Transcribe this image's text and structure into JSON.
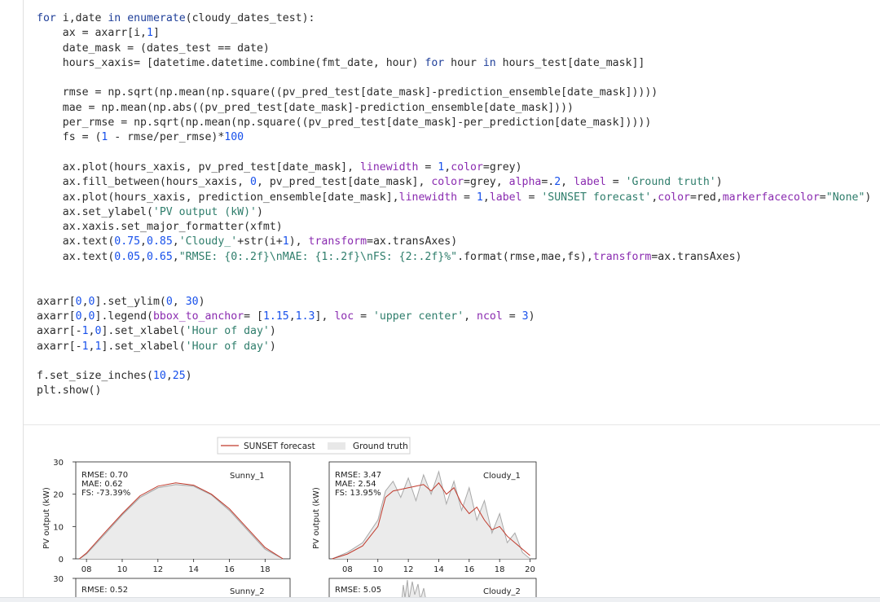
{
  "code": {
    "lines": [
      [
        {
          "t": "for",
          "c": "kw"
        },
        {
          "t": " i,date "
        },
        {
          "t": "in",
          "c": "kw"
        },
        {
          "t": " "
        },
        {
          "t": "enumerate",
          "c": "kw"
        },
        {
          "t": "(cloudy_dates_test):"
        }
      ],
      [
        {
          "t": "    ax = axarr[i,"
        },
        {
          "t": "1",
          "c": "num"
        },
        {
          "t": "]"
        }
      ],
      [
        {
          "t": "    date_mask = (dates_test == date)"
        }
      ],
      [
        {
          "t": "    hours_xaxis= [datetime.datetime.combine(fmt_date, hour) "
        },
        {
          "t": "for",
          "c": "kw"
        },
        {
          "t": " hour "
        },
        {
          "t": "in",
          "c": "kw"
        },
        {
          "t": " hours_test[date_mask]]"
        }
      ],
      [],
      [
        {
          "t": "    rmse = np.sqrt(np.mean(np.square((pv_pred_test[date_mask]-prediction_ensemble[date_mask]))))"
        }
      ],
      [
        {
          "t": "    mae = np.mean(np.abs((pv_pred_test[date_mask]-prediction_ensemble[date_mask])))"
        }
      ],
      [
        {
          "t": "    per_rmse = np.sqrt(np.mean(np.square((pv_pred_test[date_mask]-per_prediction[date_mask]))))"
        }
      ],
      [
        {
          "t": "    fs = ("
        },
        {
          "t": "1",
          "c": "num"
        },
        {
          "t": " - rmse/per_rmse)*"
        },
        {
          "t": "100",
          "c": "num"
        }
      ],
      [],
      [
        {
          "t": "    ax.plot(hours_xaxis, pv_pred_test[date_mask], "
        },
        {
          "t": "linewidth",
          "c": "kwarg"
        },
        {
          "t": " = "
        },
        {
          "t": "1",
          "c": "num"
        },
        {
          "t": ","
        },
        {
          "t": "color",
          "c": "kwarg"
        },
        {
          "t": "=grey)"
        }
      ],
      [
        {
          "t": "    ax.fill_between(hours_xaxis, "
        },
        {
          "t": "0",
          "c": "num"
        },
        {
          "t": ", pv_pred_test[date_mask], "
        },
        {
          "t": "color",
          "c": "kwarg"
        },
        {
          "t": "=grey, "
        },
        {
          "t": "alpha",
          "c": "kwarg"
        },
        {
          "t": "=."
        },
        {
          "t": "2",
          "c": "num"
        },
        {
          "t": ", "
        },
        {
          "t": "label",
          "c": "kwarg"
        },
        {
          "t": " = "
        },
        {
          "t": "'Ground truth'",
          "c": "str"
        },
        {
          "t": ")"
        }
      ],
      [
        {
          "t": "    ax.plot(hours_xaxis, prediction_ensemble[date_mask],"
        },
        {
          "t": "linewidth",
          "c": "kwarg"
        },
        {
          "t": " = "
        },
        {
          "t": "1",
          "c": "num"
        },
        {
          "t": ","
        },
        {
          "t": "label",
          "c": "kwarg"
        },
        {
          "t": " = "
        },
        {
          "t": "'SUNSET forecast'",
          "c": "str"
        },
        {
          "t": ","
        },
        {
          "t": "color",
          "c": "kwarg"
        },
        {
          "t": "=red,"
        },
        {
          "t": "markerfacecolor",
          "c": "kwarg"
        },
        {
          "t": "="
        },
        {
          "t": "\"None\"",
          "c": "str"
        },
        {
          "t": ")"
        }
      ],
      [
        {
          "t": "    ax.set_ylabel("
        },
        {
          "t": "'PV output (kW)'",
          "c": "str"
        },
        {
          "t": ")"
        }
      ],
      [
        {
          "t": "    ax.xaxis.set_major_formatter(xfmt)"
        }
      ],
      [
        {
          "t": "    ax.text("
        },
        {
          "t": "0.75",
          "c": "num"
        },
        {
          "t": ","
        },
        {
          "t": "0.85",
          "c": "num"
        },
        {
          "t": ","
        },
        {
          "t": "'Cloudy_'",
          "c": "str"
        },
        {
          "t": "+str(i+"
        },
        {
          "t": "1",
          "c": "num"
        },
        {
          "t": "), "
        },
        {
          "t": "transform",
          "c": "kwarg"
        },
        {
          "t": "=ax.transAxes)"
        }
      ],
      [
        {
          "t": "    ax.text("
        },
        {
          "t": "0.05",
          "c": "num"
        },
        {
          "t": ","
        },
        {
          "t": "0.65",
          "c": "num"
        },
        {
          "t": ","
        },
        {
          "t": "\"RMSE: {0:.2f}\\nMAE: {1:.2f}\\nFS: {2:.2f}%\"",
          "c": "str"
        },
        {
          "t": ".format(rmse,mae,fs),"
        },
        {
          "t": "transform",
          "c": "kwarg"
        },
        {
          "t": "=ax.transAxes)"
        }
      ],
      [],
      [],
      [
        {
          "t": "axarr["
        },
        {
          "t": "0",
          "c": "num"
        },
        {
          "t": ","
        },
        {
          "t": "0",
          "c": "num"
        },
        {
          "t": "].set_ylim("
        },
        {
          "t": "0",
          "c": "num"
        },
        {
          "t": ", "
        },
        {
          "t": "30",
          "c": "num"
        },
        {
          "t": ")"
        }
      ],
      [
        {
          "t": "axarr["
        },
        {
          "t": "0",
          "c": "num"
        },
        {
          "t": ","
        },
        {
          "t": "0",
          "c": "num"
        },
        {
          "t": "].legend("
        },
        {
          "t": "bbox_to_anchor",
          "c": "kwarg"
        },
        {
          "t": "= ["
        },
        {
          "t": "1.15",
          "c": "num"
        },
        {
          "t": ","
        },
        {
          "t": "1.3",
          "c": "num"
        },
        {
          "t": "], "
        },
        {
          "t": "loc",
          "c": "kwarg"
        },
        {
          "t": " = "
        },
        {
          "t": "'upper center'",
          "c": "str"
        },
        {
          "t": ", "
        },
        {
          "t": "ncol",
          "c": "kwarg"
        },
        {
          "t": " = "
        },
        {
          "t": "3",
          "c": "num"
        },
        {
          "t": ")"
        }
      ],
      [
        {
          "t": "axarr[-"
        },
        {
          "t": "1",
          "c": "num"
        },
        {
          "t": ","
        },
        {
          "t": "0",
          "c": "num"
        },
        {
          "t": "].set_xlabel("
        },
        {
          "t": "'Hour of day'",
          "c": "str"
        },
        {
          "t": ")"
        }
      ],
      [
        {
          "t": "axarr[-"
        },
        {
          "t": "1",
          "c": "num"
        },
        {
          "t": ","
        },
        {
          "t": "1",
          "c": "num"
        },
        {
          "t": "].set_xlabel("
        },
        {
          "t": "'Hour of day'",
          "c": "str"
        },
        {
          "t": ")"
        }
      ],
      [],
      [
        {
          "t": "f.set_size_inches("
        },
        {
          "t": "10",
          "c": "num"
        },
        {
          "t": ","
        },
        {
          "t": "25",
          "c": "num"
        },
        {
          "t": ")"
        }
      ],
      [
        {
          "t": "plt.show()"
        }
      ]
    ]
  },
  "figure": {
    "legend": {
      "forecast_label": "SUNSET forecast",
      "truth_label": "Ground truth",
      "forecast_color": "#c0392b",
      "truth_color": "#a9a9a9"
    },
    "ylabel": "PV output (kW)",
    "panels": {
      "sunny_1": {
        "title": "Sunny_1",
        "rmse": "RMSE: 0.70",
        "mae": "MAE: 0.62",
        "fs": "FS: -73.39%"
      },
      "cloudy_1": {
        "title": "Cloudy_1",
        "rmse": "RMSE: 3.47",
        "mae": "MAE: 2.54",
        "fs": "FS: 13.95%"
      },
      "sunny_2": {
        "title": "Sunny_2",
        "rmse": "RMSE: 0.52"
      },
      "cloudy_2": {
        "title": "Cloudy_2",
        "rmse": "RMSE: 5.05"
      }
    },
    "ticks": {
      "y": [
        "0",
        "10",
        "20",
        "30"
      ],
      "y_top_row2": "30",
      "x_sunny": [
        "08",
        "10",
        "12",
        "14",
        "16",
        "18"
      ],
      "x_cloudy": [
        "08",
        "10",
        "12",
        "14",
        "16",
        "18",
        "20"
      ]
    }
  },
  "chart_data": [
    {
      "type": "line",
      "title": "Sunny_1",
      "ylabel": "PV output (kW)",
      "ylim": [
        0,
        30
      ],
      "xlim": [
        7.4,
        19.4
      ],
      "series": [
        {
          "name": "SUNSET forecast",
          "x": [
            7.6,
            8,
            9,
            10,
            11,
            12,
            13,
            14,
            15,
            16,
            17,
            18,
            19
          ],
          "y": [
            0,
            1.8,
            8,
            14,
            19.5,
            22.5,
            23.5,
            22.8,
            20,
            15.5,
            9.5,
            3.5,
            0
          ]
        },
        {
          "name": "Ground truth",
          "x": [
            7.6,
            8,
            9,
            10,
            11,
            12,
            13,
            14,
            15,
            16,
            17,
            18,
            19
          ],
          "y": [
            0,
            1.5,
            7.5,
            13.6,
            19,
            22,
            23,
            22.5,
            19.8,
            15,
            9,
            3,
            0
          ]
        }
      ],
      "annotations": [
        "RMSE: 0.70",
        "MAE: 0.62",
        "FS: -73.39%"
      ]
    },
    {
      "type": "line",
      "title": "Cloudy_1",
      "ylabel": "PV output (kW)",
      "ylim": [
        0,
        30
      ],
      "xlim": [
        6.8,
        20.4
      ],
      "series": [
        {
          "name": "SUNSET forecast",
          "x": [
            7,
            8,
            9,
            10,
            10.5,
            11,
            12,
            12.5,
            13,
            13.5,
            14,
            14.5,
            15,
            15.5,
            16,
            16.5,
            17,
            17.5,
            18,
            18.5,
            19,
            19.5,
            20
          ],
          "y": [
            0,
            1.5,
            4,
            10,
            19,
            21,
            22,
            22.5,
            23,
            21,
            23.5,
            20,
            22,
            17,
            14,
            16,
            12,
            9,
            10,
            7,
            5,
            3,
            1
          ]
        },
        {
          "name": "Ground truth",
          "x": [
            7,
            8,
            9,
            10,
            10.5,
            11,
            11.5,
            12,
            12.5,
            13,
            13.5,
            14,
            14.5,
            15,
            15.5,
            16,
            16.5,
            17,
            17.5,
            18,
            18.5,
            19,
            19.5,
            20
          ],
          "y": [
            0,
            2,
            5,
            12,
            21,
            24,
            19,
            25,
            18,
            26,
            20,
            27,
            17,
            24,
            15,
            22,
            12,
            18,
            8,
            14,
            5,
            8,
            2,
            0
          ]
        }
      ],
      "annotations": [
        "RMSE: 3.47",
        "MAE: 2.54",
        "FS: 13.95%"
      ]
    }
  ]
}
